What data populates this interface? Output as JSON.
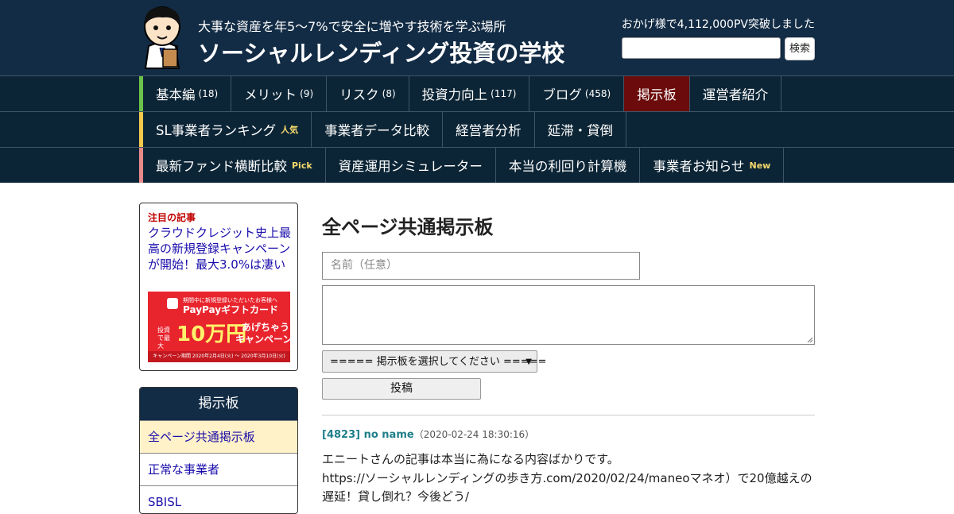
{
  "header": {
    "tagline": "大事な資産を年5～7%で安全に増やす技術を学ぶ場所",
    "site_title": "ソーシャルレンディング投資の学校",
    "pv_text": "おかげ様で4,112,000PV突破しました",
    "search_placeholder": "",
    "search_button": "検索",
    "colors": {
      "background": "#132c45",
      "nav": "#0c2536",
      "active": "#6b0b0b"
    }
  },
  "nav": {
    "row1": [
      {
        "label": "基本編",
        "count": "(18)"
      },
      {
        "label": "メリット",
        "count": "(9)"
      },
      {
        "label": "リスク",
        "count": "(8)"
      },
      {
        "label": "投資力向上",
        "count": "(117)"
      },
      {
        "label": "ブログ",
        "count": "(458)"
      },
      {
        "label": "掲示板",
        "count": ""
      },
      {
        "label": "運営者紹介",
        "count": ""
      }
    ],
    "row2": [
      {
        "label": "SL事業者ランキング",
        "badge": "人気"
      },
      {
        "label": "事業者データ比較",
        "badge": ""
      },
      {
        "label": "経営者分析",
        "badge": ""
      },
      {
        "label": "延滞・貸倒",
        "badge": ""
      }
    ],
    "row3": [
      {
        "label": "最新ファンド横断比較",
        "badge": "Pick"
      },
      {
        "label": "資産運用シミュレーター",
        "badge": ""
      },
      {
        "label": "本当の利回り計算機",
        "badge": ""
      },
      {
        "label": "事業者お知らせ",
        "badge": "New"
      }
    ],
    "marker_colors": [
      "#6cc24a",
      "#f2c94c",
      "#e88a8a"
    ]
  },
  "sidebar": {
    "featured_label": "注目の記事",
    "featured_link": "クラウドクレジット史上最高の新規登録キャンペーンが開始！最大3.0%は凄い",
    "banner": {
      "line1": "期間中に新規登録いただいたお客様へ",
      "line2": "PayPayギフトカード",
      "amount": "10万円",
      "sub1": "あげちゃう!",
      "sub2": "キャンペーン",
      "prefix": "投資で最大",
      "period": "キャンペーン期間 2020年2月4日(火) ～ 2020年3月10日(火)"
    },
    "board_title": "掲示板",
    "board_items": [
      "全ページ共通掲示板",
      "正常な事業者",
      "SBISL"
    ]
  },
  "main": {
    "title": "全ページ共通掲示板",
    "name_placeholder": "名前（任意）",
    "select_value": "===== 掲示板を選択してください =====",
    "post_button": "投稿",
    "post": {
      "id_name": "[4823] no name",
      "date": "（2020-02-24 18:30:16）",
      "line1": "エニートさんの記事は本当に為になる内容ばかりです。",
      "line2": "https://ソーシャルレンディングの歩き方.com/2020/02/24/maneoマネオ）で20億越えの遅延！貸し倒れ？今後どう/"
    }
  }
}
